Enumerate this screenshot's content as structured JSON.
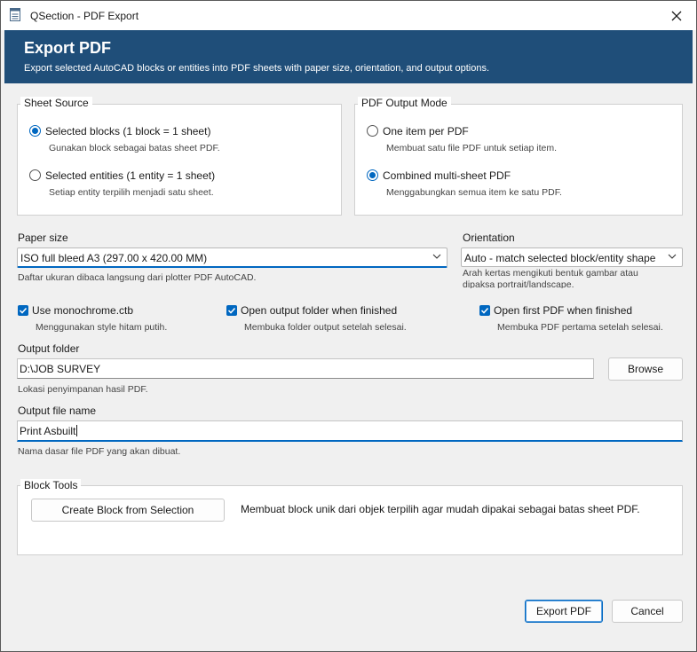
{
  "window": {
    "title": "QSection - PDF Export"
  },
  "header": {
    "title": "Export PDF",
    "subtitle": "Export selected AutoCAD blocks or entities into PDF sheets with paper size, orientation, and output options."
  },
  "sheet_source": {
    "label": "Sheet Source",
    "options": [
      {
        "label": "Selected blocks (1 block = 1 sheet)",
        "hint": "Gunakan block sebagai batas sheet PDF.",
        "checked": true
      },
      {
        "label": "Selected entities (1 entity = 1 sheet)",
        "hint": "Setiap entity terpilih menjadi satu sheet.",
        "checked": false
      }
    ]
  },
  "output_mode": {
    "label": "PDF Output Mode",
    "options": [
      {
        "label": "One item per PDF",
        "hint": "Membuat satu file PDF untuk setiap item.",
        "checked": false
      },
      {
        "label": "Combined multi-sheet PDF",
        "hint": "Menggabungkan semua item ke satu PDF.",
        "checked": true
      }
    ]
  },
  "paper_size": {
    "label": "Paper size",
    "value": "ISO full bleed A3 (297.00 x 420.00 MM)",
    "hint": "Daftar ukuran dibaca langsung dari plotter PDF AutoCAD."
  },
  "orientation": {
    "label": "Orientation",
    "value": "Auto - match selected block/entity shape",
    "hint_line1": "Arah kertas mengikuti bentuk gambar atau",
    "hint_line2": "dipaksa portrait/landscape."
  },
  "checkboxes": [
    {
      "label": "Use monochrome.ctb",
      "hint": "Menggunakan style hitam putih.",
      "checked": true
    },
    {
      "label": "Open output folder when finished",
      "hint": "Membuka folder output setelah selesai.",
      "checked": true
    },
    {
      "label": "Open first PDF when finished",
      "hint": "Membuka PDF pertama setelah selesai.",
      "checked": true
    }
  ],
  "output_folder": {
    "label": "Output folder",
    "value": "D:\\JOB SURVEY",
    "hint": "Lokasi penyimpanan hasil PDF.",
    "browse_label": "Browse"
  },
  "output_file": {
    "label": "Output file name",
    "value": "Print Asbuilt",
    "hint": "Nama dasar file PDF yang akan dibuat."
  },
  "block_tools": {
    "label": "Block Tools",
    "button_label": "Create Block from Selection",
    "description": "Membuat block unik dari objek terpilih agar mudah dipakai sebagai batas sheet PDF."
  },
  "footer": {
    "export_label": "Export PDF",
    "cancel_label": "Cancel"
  },
  "colors": {
    "accent": "#0067c0",
    "header_bg": "#1f4e79"
  }
}
